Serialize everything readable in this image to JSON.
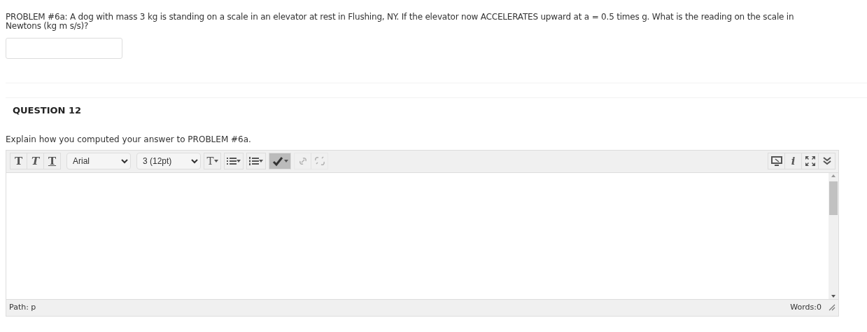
{
  "problem": {
    "lines": [
      "PROBLEM #6a: A dog with mass 3 kg is standing on a scale in an elevator at rest in Flushing, NY. If the elevator now ACCELERATES upward at a = 0.5 times g.  What is the reading on the scale in",
      "Newtons (kg m s/s)?"
    ]
  },
  "question": {
    "title": "QUESTION 12",
    "prompt": "Explain how you computed your answer to PROBLEM #6a."
  },
  "editor": {
    "toolbar_left": [
      {
        "kind": "bold",
        "label": "T"
      },
      {
        "kind": "italic",
        "label": "T"
      },
      {
        "kind": "underline",
        "label": "T"
      },
      {
        "kind": "select",
        "value": "Arial"
      },
      {
        "kind": "select",
        "value": "3 (12pt)"
      },
      {
        "kind": "textcolor",
        "label": "T",
        "dropdown": true
      },
      {
        "kind": "bullets",
        "dropdown": true
      },
      {
        "kind": "numbers",
        "dropdown": true
      },
      {
        "kind": "spellcheck",
        "dropdown": true,
        "pressed": true
      },
      {
        "kind": "link",
        "disabled": true
      },
      {
        "kind": "unlink",
        "disabled": true
      }
    ],
    "toolbar_right": [
      {
        "kind": "preview"
      },
      {
        "kind": "info",
        "label": "i"
      },
      {
        "kind": "fullscreen"
      },
      {
        "kind": "more"
      }
    ],
    "path": "Path: p",
    "words": "Words:0"
  }
}
